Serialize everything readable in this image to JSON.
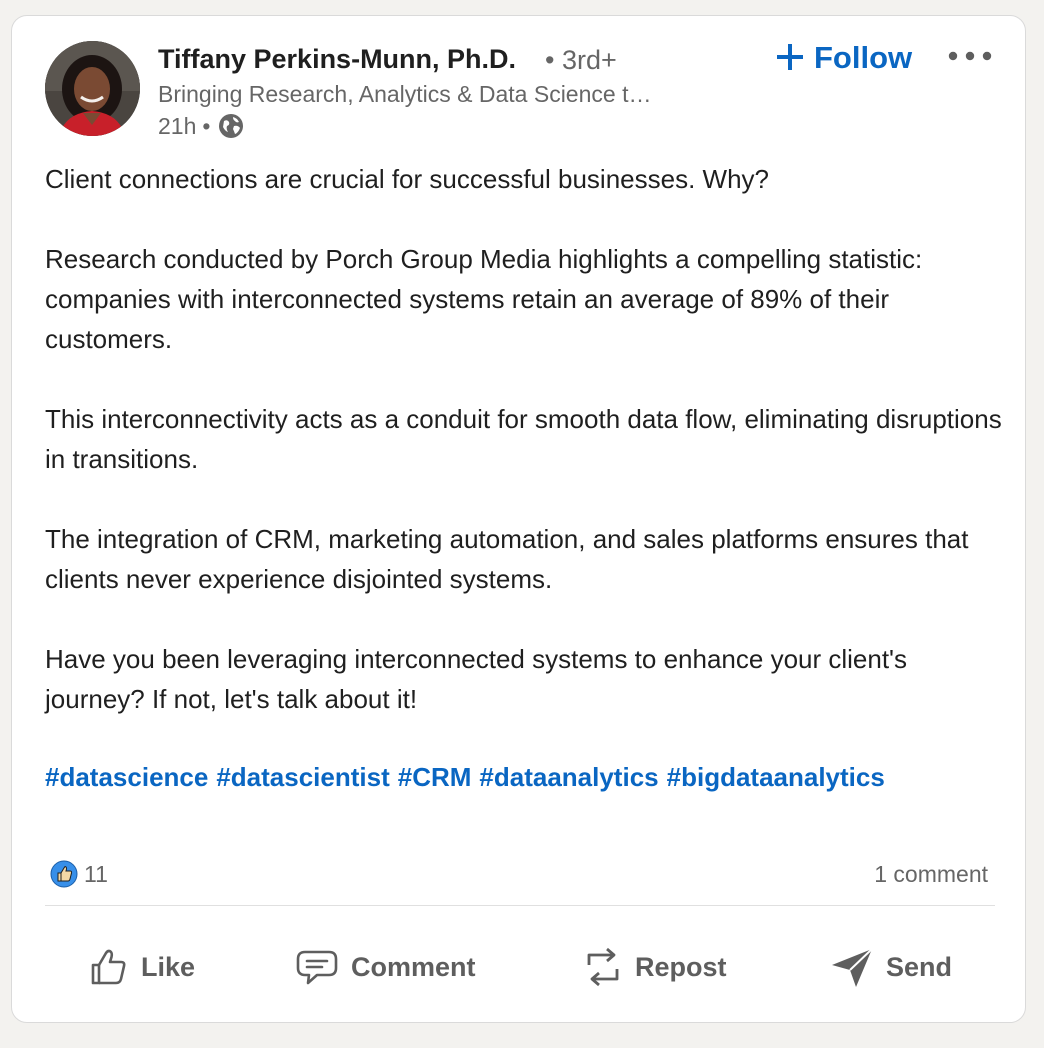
{
  "post": {
    "author": {
      "name": "Tiffany Perkins-Munn, Ph.D.",
      "degree": "• 3rd+",
      "headline": "Bringing Research, Analytics & Data Science t…",
      "time": "21h",
      "separator": "•",
      "visibility_icon": "globe-icon"
    },
    "follow_label": "Follow",
    "more_icon": "more-horizontal-icon",
    "paragraphs": [
      "Client connections are crucial for successful businesses. Why?",
      "Research conducted by Porch Group Media highlights a compelling statistic: companies with interconnected systems retain an average of 89% of their customers.",
      "This interconnectivity acts as a conduit for smooth data flow, eliminating disruptions in transitions.",
      "The integration of CRM, marketing automation, and sales platforms ensures that clients never experience disjointed systems.",
      "Have you been leveraging interconnected systems to enhance your client's journey? If not, let's talk about it!"
    ],
    "hashtags": [
      "#datascience",
      "#datascientist",
      "#CRM",
      "#dataanalytics",
      "#bigdataanalytics"
    ],
    "reaction_count": "11",
    "comments_label": "1 comment"
  },
  "actions": {
    "like": "Like",
    "comment": "Comment",
    "repost": "Repost",
    "send": "Send"
  },
  "colors": {
    "accent": "#0a66c2",
    "muted_text": "#666666",
    "body_text": "#1f1f1f",
    "action_text": "#5e5e5e"
  }
}
